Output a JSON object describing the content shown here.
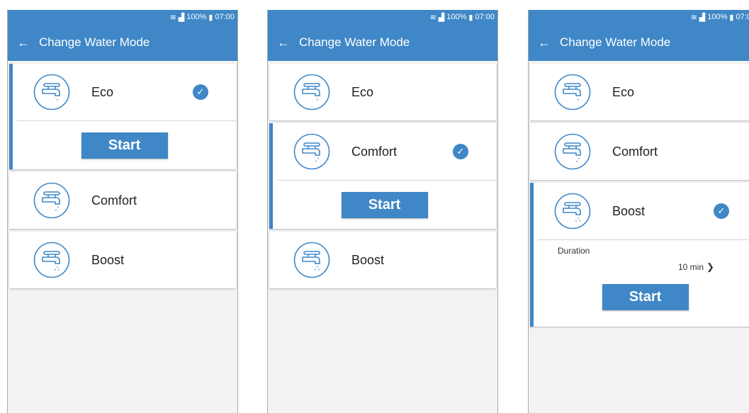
{
  "status_bar": {
    "wifi_icon": "wifi-icon",
    "signal_icon": "signal-icon",
    "battery": "100%",
    "time": "07:00"
  },
  "app_bar": {
    "title": "Change Water Mode",
    "back_icon": "arrow-left-icon"
  },
  "modes": [
    {
      "label": "Eco",
      "icon": "faucet-drop-icon",
      "drops": 1
    },
    {
      "label": "Comfort",
      "icon": "faucet-drops-icon",
      "drops": 2
    },
    {
      "label": "Boost",
      "icon": "faucet-many-drops-icon",
      "drops": 3
    }
  ],
  "start_label": "Start",
  "duration": {
    "label": "Duration",
    "value": "10 min"
  },
  "screens": [
    {
      "selected": "Eco"
    },
    {
      "selected": "Comfort"
    },
    {
      "selected": "Boost"
    }
  ],
  "colors": {
    "accent": "#3f87c7",
    "background": "#f3f3f3",
    "card": "#ffffff"
  }
}
